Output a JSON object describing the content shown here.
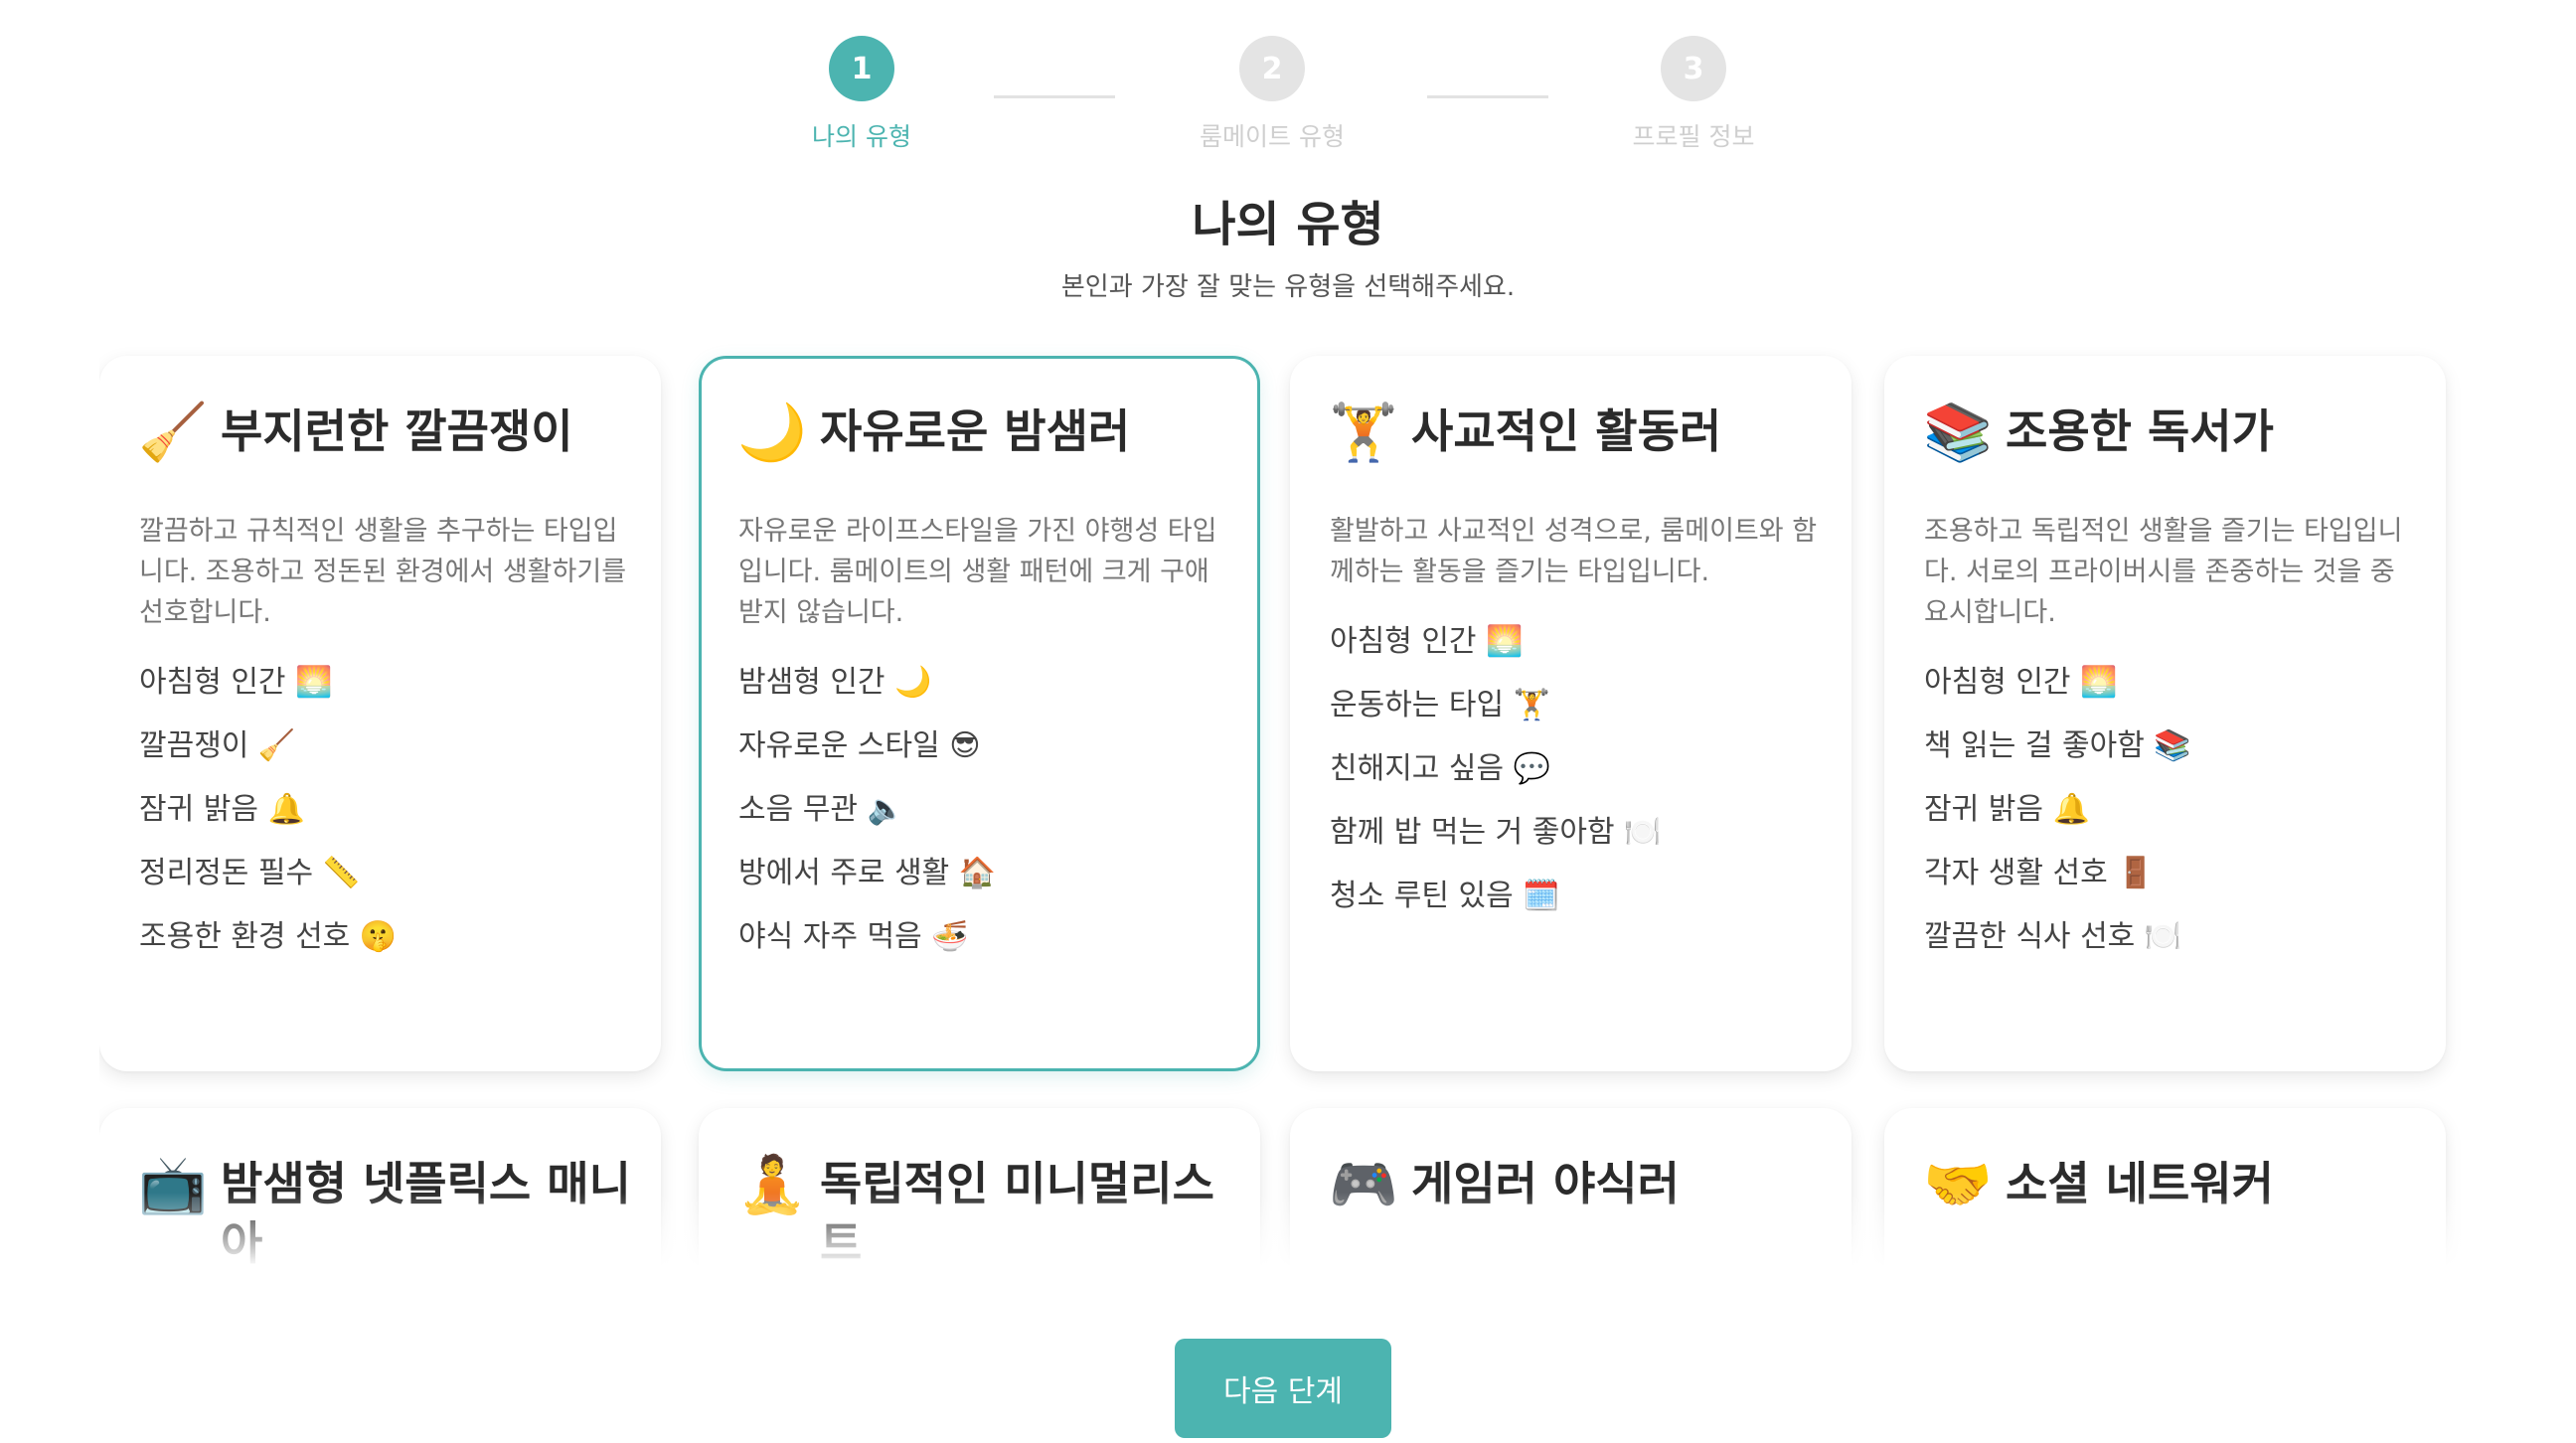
{
  "stepper": {
    "steps": [
      {
        "number": "1",
        "label": "나의 유형"
      },
      {
        "number": "2",
        "label": "룸메이트 유형"
      },
      {
        "number": "3",
        "label": "프로필 정보"
      }
    ]
  },
  "header": {
    "title": "나의 유형",
    "subtitle": "본인과 가장 잘 맞는 유형을 선택해주세요."
  },
  "cards": [
    {
      "icon": "🧹",
      "title": "부지런한 깔끔쟁이",
      "description": "깔끔하고 규칙적인 생활을 추구하는 타입입니다. 조용하고 정돈된 환경에서 생활하기를 선호합니다.",
      "traits": [
        "아침형 인간 🌅",
        "깔끔쟁이 🧹",
        "잠귀 밝음 🔔",
        "정리정돈 필수 📏",
        "조용한 환경 선호 🤫"
      ]
    },
    {
      "icon": "🌙",
      "title": "자유로운 밤샘러",
      "description": "자유로운 라이프스타일을 가진 야행성 타입입니다. 룸메이트의 생활 패턴에 크게 구애받지 않습니다.",
      "traits": [
        "밤샘형 인간 🌙",
        "자유로운 스타일 😎",
        "소음 무관 🔈",
        "방에서 주로 생활 🏠",
        "야식 자주 먹음 🍜"
      ]
    },
    {
      "icon": "🏋️",
      "title": "사교적인 활동러",
      "description": "활발하고 사교적인 성격으로, 룸메이트와 함께하는 활동을 즐기는 타입입니다.",
      "traits": [
        "아침형 인간 🌅",
        "운동하는 타입 🏋️",
        "친해지고 싶음 💬",
        "함께 밥 먹는 거 좋아함 🍽️",
        "청소 루틴 있음 🗓️"
      ]
    },
    {
      "icon": "📚",
      "title": "조용한 독서가",
      "description": "조용하고 독립적인 생활을 즐기는 타입입니다. 서로의 프라이버시를 존중하는 것을 중요시합니다.",
      "traits": [
        "아침형 인간 🌅",
        "책 읽는 걸 좋아함 📚",
        "잠귀 밝음 🔔",
        "각자 생활 선호 🚪",
        "깔끔한 식사 선호 🍽️"
      ]
    },
    {
      "icon": "📺",
      "title": "밤샘형 넷플릭스 매니아"
    },
    {
      "icon": "🧘",
      "title": "독립적인 미니멀리스트"
    },
    {
      "icon": "🎮",
      "title": "게임러 야식러"
    },
    {
      "icon": "🤝",
      "title": "소셜 네트워커"
    }
  ],
  "actions": {
    "next_label": "다음 단계"
  },
  "colors": {
    "accent": "#4cb4b0",
    "step_inactive": "#e4e4e4"
  }
}
